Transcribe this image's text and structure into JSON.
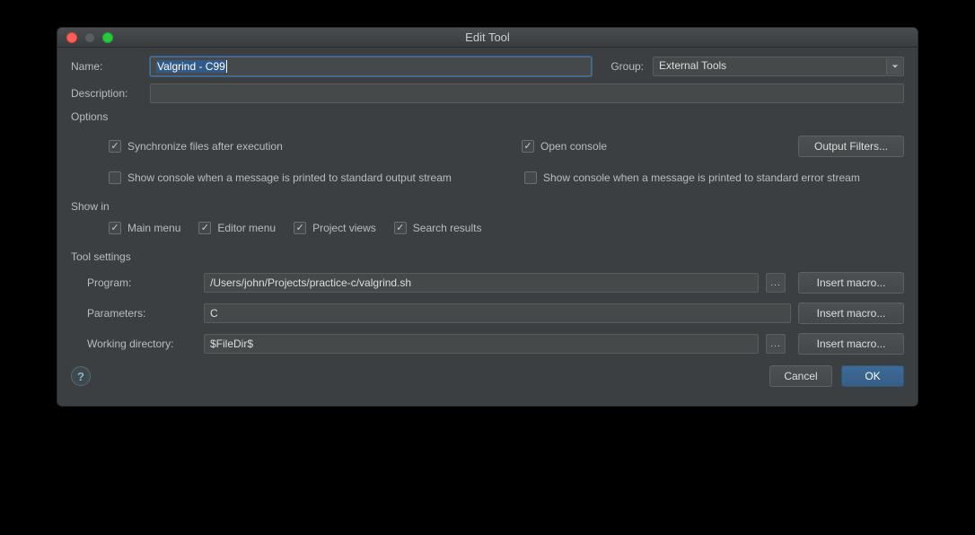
{
  "window": {
    "title": "Edit Tool"
  },
  "labels": {
    "name": "Name:",
    "group": "Group:",
    "description": "Description:",
    "options": "Options",
    "show_in": "Show in",
    "tool_settings": "Tool settings",
    "program": "Program:",
    "parameters": "Parameters:",
    "working_dir": "Working directory:"
  },
  "fields": {
    "name": "Valgrind - C99",
    "group": "External Tools",
    "description": "",
    "program": "/Users/john/Projects/practice-c/valgrind.sh",
    "parameters": "C",
    "working_dir": "$FileDir$"
  },
  "checks": {
    "sync_files": {
      "label": "Synchronize files after execution",
      "checked": true
    },
    "open_console": {
      "label": "Open console",
      "checked": true
    },
    "show_stdout": {
      "label": "Show console when a message is printed to standard output stream",
      "checked": false
    },
    "show_stderr": {
      "label": "Show console when a message is printed to standard error stream",
      "checked": false
    },
    "main_menu": {
      "label": "Main menu",
      "checked": true
    },
    "editor_menu": {
      "label": "Editor menu",
      "checked": true
    },
    "project_views": {
      "label": "Project views",
      "checked": true
    },
    "search_results": {
      "label": "Search results",
      "checked": true
    }
  },
  "buttons": {
    "output_filters": "Output Filters...",
    "insert_macro": "Insert macro...",
    "cancel": "Cancel",
    "ok": "OK",
    "browse": "..."
  }
}
